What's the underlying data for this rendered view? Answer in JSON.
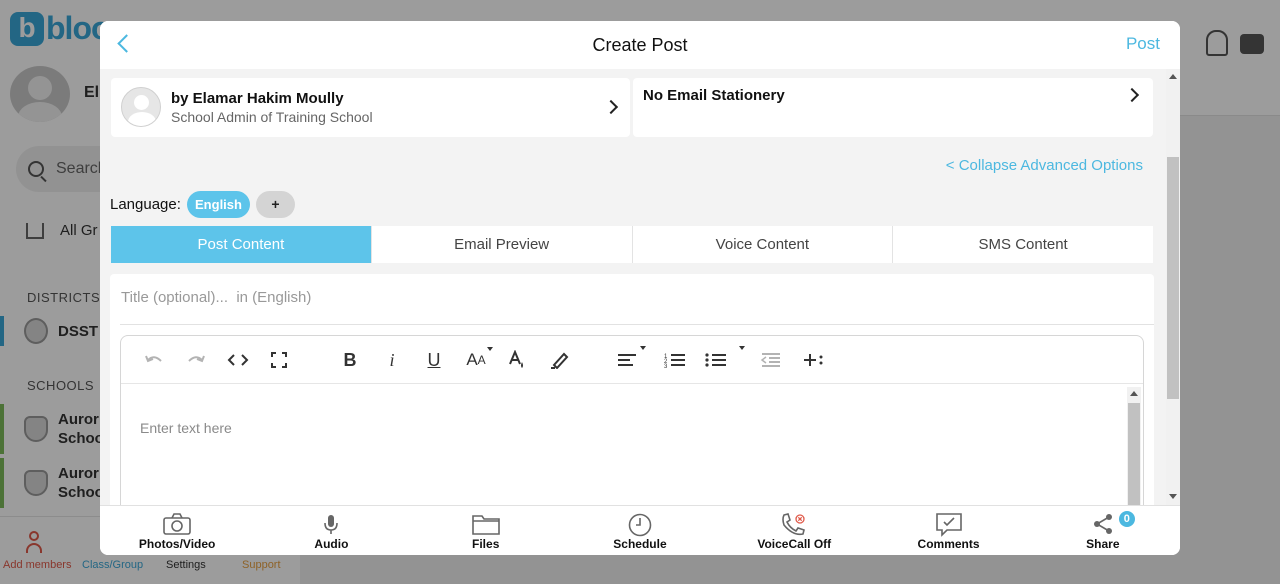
{
  "background": {
    "logo_text": "bloo",
    "user_name": "El",
    "search_placeholder": "Search",
    "all_groups": "All Gr",
    "districts_heading": "DISTRICTS",
    "district_item": "DSST",
    "schools_heading": "SCHOOLS",
    "schools": [
      {
        "line1": "Auror",
        "line2": "Schoo"
      },
      {
        "line1": "Auror",
        "line2": "Schoo"
      }
    ],
    "bottom_nav": {
      "add_members": "Add members",
      "class_group": "Class/Group",
      "settings": "Settings",
      "support": "Support"
    }
  },
  "modal": {
    "title": "Create Post",
    "post_label": "Post",
    "author": {
      "name": "by Elamar Hakim Moully",
      "role": "School Admin of Training School"
    },
    "stationery": "No Email Stationery",
    "collapse_link": "< Collapse Advanced Options",
    "language": {
      "label": "Language:",
      "selected": "English",
      "add": "+"
    },
    "tabs": [
      {
        "label": "Post Content",
        "active": true
      },
      {
        "label": "Email Preview",
        "active": false
      },
      {
        "label": "Voice Content",
        "active": false
      },
      {
        "label": "SMS Content",
        "active": false
      }
    ],
    "title_placeholder": "Title (optional)...  in (English)",
    "editor_placeholder": "Enter text here",
    "toolbar_icons": [
      "undo-icon",
      "redo-icon",
      "code-view-icon",
      "fullscreen-icon",
      "bold-icon",
      "italic-icon",
      "underline-icon",
      "font-size-icon",
      "font-color-icon",
      "highlight-icon",
      "align-icon",
      "ordered-list-icon",
      "unordered-list-icon",
      "outdent-icon",
      "insert-icon"
    ],
    "bottom_bar": [
      {
        "label": "Photos/Video",
        "icon": "camera-icon"
      },
      {
        "label": "Audio",
        "icon": "microphone-icon"
      },
      {
        "label": "Files",
        "icon": "folder-icon"
      },
      {
        "label": "Schedule",
        "icon": "clock-icon"
      },
      {
        "label": "VoiceCall Off",
        "icon": "phone-off-icon"
      },
      {
        "label": "Comments",
        "icon": "comment-icon"
      },
      {
        "label": "Share",
        "icon": "share-icon",
        "badge": "0"
      }
    ]
  },
  "colors": {
    "accent": "#4cb8e0",
    "active_tab": "#5dc4ea",
    "alert": "#e05a4a"
  }
}
